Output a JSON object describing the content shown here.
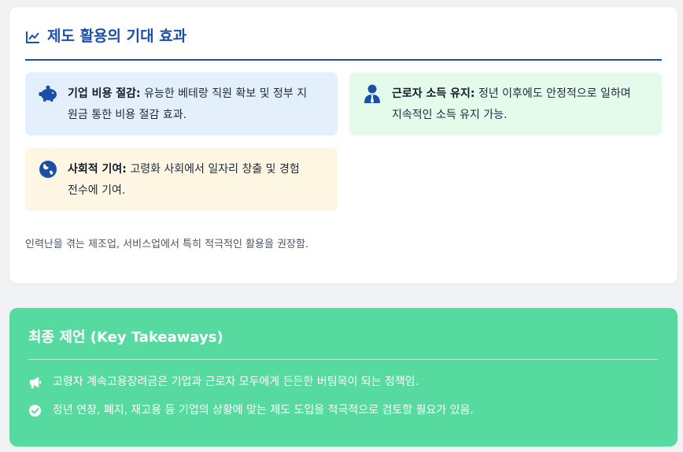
{
  "effects": {
    "title": "제도 활용의 기대 효과",
    "title_icon": "chart-line-icon",
    "accent_color": "#1b4fa8",
    "boxes": [
      {
        "icon": "piggy-bank-icon",
        "heading": "기업 비용 절감:",
        "text_line1": " 유능한 베테랑 직원 확보 및 정부 지",
        "text_line2": "원금 통한 비용 절감 효과.",
        "bg": "#e4effc"
      },
      {
        "icon": "user-tie-icon",
        "heading": "근로자 소득 유지:",
        "text_line1": " 정년 이후에도 안정적으로 일하며",
        "text_line2": "지속적인 소득 유지 가능.",
        "bg": "#e4faea"
      },
      {
        "icon": "globe-icon",
        "heading": "사회적 기여:",
        "text_line1": " 고령화 사회에서 일자리 창출 및 경험",
        "text_line2": "전수에 기여.",
        "bg": "#fdf6e2"
      }
    ],
    "note": "인력난을 겪는 제조업, 서비스업에서 특히 적극적인 활용을 권장함."
  },
  "takeaways": {
    "title": "최종 제언 (Key Takeaways)",
    "bg": "#56da9f",
    "items": [
      {
        "icon": "megaphone-icon",
        "text": "고령자 계속고용장려금은 기업과 근로자 모두에게 든든한 버팀목이 되는 정책임."
      },
      {
        "icon": "check-circle-icon",
        "text": "정년 연장, 폐지, 재고용 등 기업의 상황에 맞는 제도 도입을 적극적으로 검토할 필요가 있음."
      }
    ]
  }
}
